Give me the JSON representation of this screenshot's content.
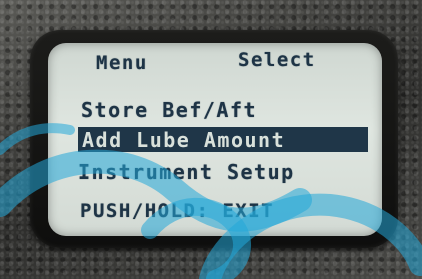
{
  "screen": {
    "header": {
      "left": "Menu",
      "right": "Select"
    },
    "menu": {
      "items": [
        "Store Bef/Aft",
        "Add Lube Amount",
        "Instrument Setup"
      ],
      "selected": "Add Lube Amount"
    },
    "footer": "PUSH/HOLD:  EXIT"
  },
  "colors": {
    "lcd_background": "#d9e0da",
    "lcd_text": "#1e3446",
    "highlight": "#1f3648",
    "watermark": "#23a8d8"
  }
}
